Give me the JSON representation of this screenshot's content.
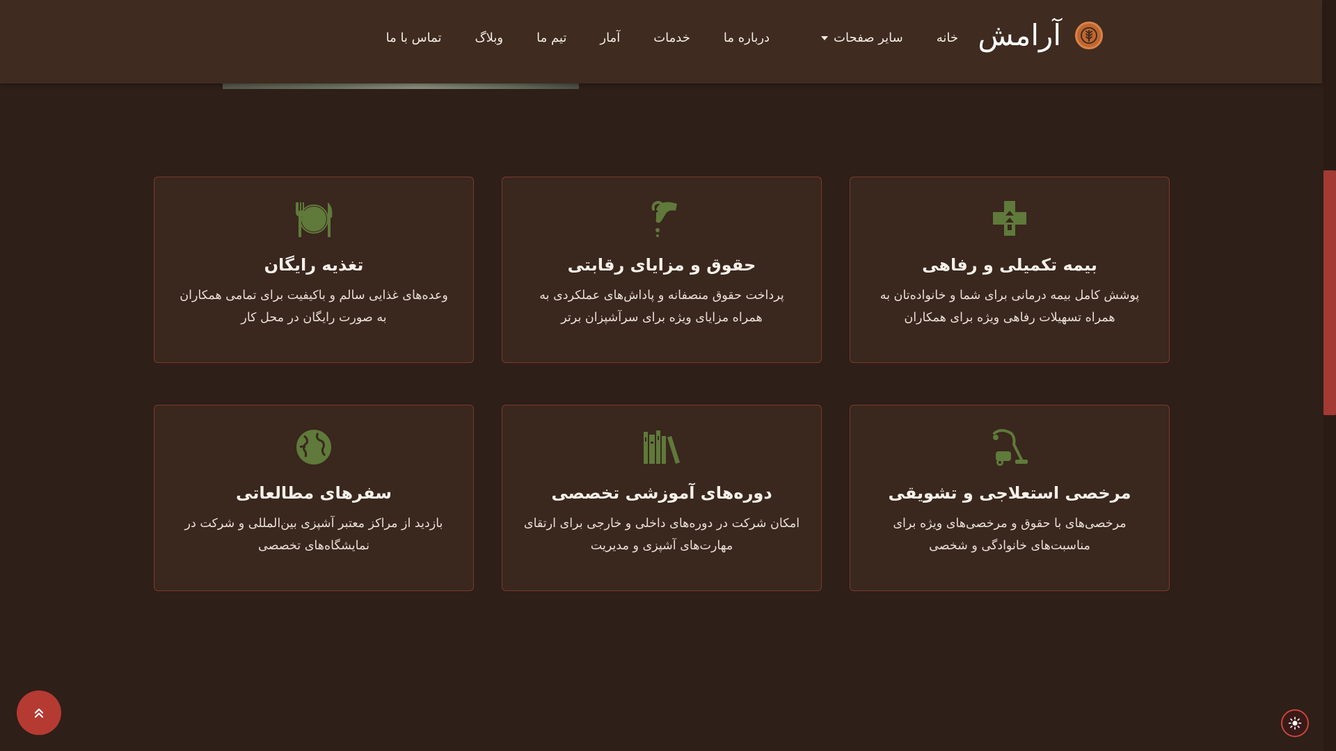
{
  "brand": {
    "name": "آرامش",
    "logo_icon": "wheat-icon"
  },
  "nav": [
    {
      "label": "خانه"
    },
    {
      "label": "سایر صفحات",
      "has_dropdown": true
    },
    {
      "label": "درباره ما"
    },
    {
      "label": "خدمات"
    },
    {
      "label": "آمار"
    },
    {
      "label": "تیم ما"
    },
    {
      "label": "وبلاگ"
    },
    {
      "label": "تماس با ما"
    }
  ],
  "cards": [
    {
      "icon": "health-insurance-icon",
      "title": "بیمه تکمیلی و رفاهی",
      "desc": "پوشش کامل بیمه درمانی برای شما و خانواده‌تان به همراه تسهیلات رفاهی ویژه برای همکاران"
    },
    {
      "icon": "hand-money-icon",
      "title": "حقوق و مزایای رقابتی",
      "desc": "پرداخت حقوق منصفانه و پاداش‌های عملکردی به همراه مزایای ویژه برای سرآشپزان برتر"
    },
    {
      "icon": "plate-utensils-icon",
      "title": "تغذیه رایگان",
      "desc": "وعده‌های غذایی سالم و باکیفیت برای تمامی همکاران به صورت رایگان در محل کار"
    },
    {
      "icon": "vacuum-icon",
      "title": "مرخصی استعلاجی و تشویقی",
      "desc": "مرخصی‌های با حقوق و مرخصی‌های ویژه برای مناسبت‌های خانوادگی و شخصی"
    },
    {
      "icon": "books-icon",
      "title": "دوره‌های آموزشی تخصصی",
      "desc": "امکان شرکت در دوره‌های داخلی و خارجی برای ارتقای مهارت‌های آشپزی و مدیریت"
    },
    {
      "icon": "globe-icon",
      "title": "سفرهای مطالعاتی",
      "desc": "بازدید از مراکز معتبر آشپزی بین‌المللی و شرکت در نمایشگاه‌های تخصصی"
    }
  ],
  "colors": {
    "background": "#2e1f18",
    "header": "#3f2b20",
    "card_border": "#7a3a2f",
    "icon_green": "#5f7a3a",
    "accent_red": "#b53a32"
  },
  "controls": {
    "back_to_top_icon": "double-chevron-up-icon",
    "theme_toggle_icon": "sun-icon"
  }
}
